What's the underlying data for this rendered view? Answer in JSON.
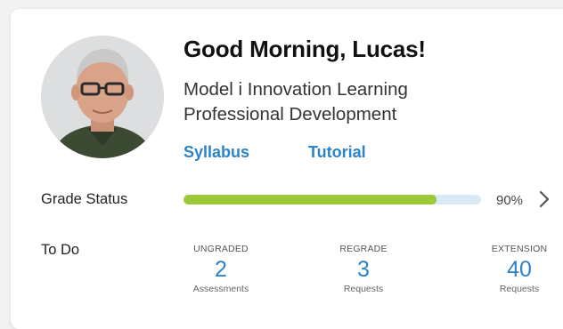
{
  "header": {
    "greeting": "Good Morning, Lucas!",
    "course_name": "Model i Innovation Learning Professional Development"
  },
  "links": {
    "syllabus": "Syllabus",
    "tutorial": "Tutorial"
  },
  "grade_status": {
    "label": "Grade Status",
    "percent_text": "90%",
    "progress_fraction": 0.85
  },
  "todo": {
    "label": "To Do",
    "items": [
      {
        "caption": "UNGRADED",
        "count": "2",
        "sub": "Assessments"
      },
      {
        "caption": "REGRADE",
        "count": "3",
        "sub": "Requests"
      },
      {
        "caption": "EXTENSION",
        "count": "40",
        "sub": "Requests"
      }
    ]
  },
  "colors": {
    "accent_blue": "#2d83c7",
    "progress_green": "#9bc93a",
    "progress_track": "#dbe9f6"
  },
  "icons": {
    "avatar": "user-photo",
    "chevron": "chevron-right-icon"
  }
}
